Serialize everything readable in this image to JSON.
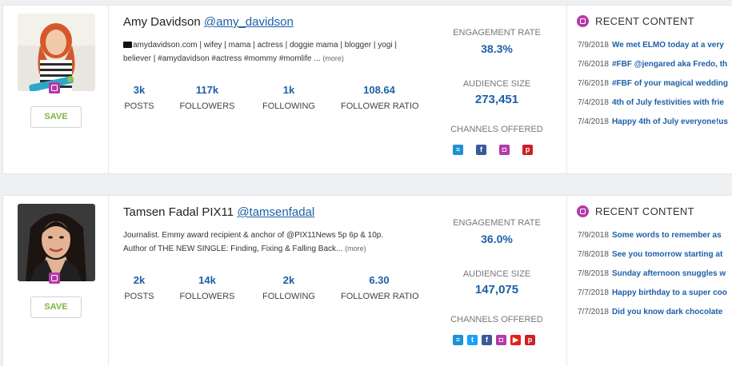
{
  "influencers": [
    {
      "name": "Amy Davidson",
      "handle": "@amy_davidson",
      "bio_line1": "amydavidson.com | wifey | mama | actress | doggie mama | blogger | yogi |",
      "bio_line2": "believer | #amydavidson #actress #mommy #momlife ...",
      "more": "(more)",
      "save_label": "SAVE",
      "stats": [
        {
          "value": "3k",
          "label": "POSTS"
        },
        {
          "value": "117k",
          "label": "FOLLOWERS"
        },
        {
          "value": "1k",
          "label": "FOLLOWING"
        },
        {
          "value": "108.64",
          "label": "FOLLOWER RATIO"
        }
      ],
      "engagement_label": "ENGAGEMENT RATE",
      "engagement_value": "38.3%",
      "audience_label": "AUDIENCE SIZE",
      "audience_value": "273,451",
      "channels_label": "CHANNELS OFFERED",
      "channels": [
        "website-icon",
        "facebook-icon",
        "instagram-icon",
        "pinterest-icon"
      ],
      "recent_title": "RECENT CONTENT",
      "recent": [
        {
          "date": "7/9/2018",
          "text": "We met ELMO today at a very"
        },
        {
          "date": "7/6/2018",
          "text": "#FBF @jengared aka Fredo, th"
        },
        {
          "date": "7/6/2018",
          "text": "#FBF of your magical wedding"
        },
        {
          "date": "7/4/2018",
          "text": "4th of July festivities with frie"
        },
        {
          "date": "7/4/2018",
          "text": "Happy 4th of July everyone!us"
        }
      ]
    },
    {
      "name": "Tamsen Fadal PIX11",
      "handle": "@tamsenfadal",
      "bio_line1": "Journalist. Emmy award recipient & anchor of @PIX11News 5p 6p & 10p.",
      "bio_line2": "Author of THE NEW SINGLE: Finding, Fixing & Falling Back...",
      "more": "(more)",
      "save_label": "SAVE",
      "stats": [
        {
          "value": "2k",
          "label": "POSTS"
        },
        {
          "value": "14k",
          "label": "FOLLOWERS"
        },
        {
          "value": "2k",
          "label": "FOLLOWING"
        },
        {
          "value": "6.30",
          "label": "FOLLOWER RATIO"
        }
      ],
      "engagement_label": "ENGAGEMENT RATE",
      "engagement_value": "36.0%",
      "audience_label": "AUDIENCE SIZE",
      "audience_value": "147,075",
      "channels_label": "CHANNELS OFFERED",
      "channels": [
        "website-icon",
        "twitter-icon",
        "facebook-icon",
        "instagram-icon",
        "youtube-icon",
        "pinterest-icon"
      ],
      "recent_title": "RECENT CONTENT",
      "recent": [
        {
          "date": "7/9/2018",
          "text": "Some words to remember as"
        },
        {
          "date": "7/8/2018",
          "text": "See you tomorrow starting at"
        },
        {
          "date": "7/8/2018",
          "text": "Sunday afternoon snuggles w"
        },
        {
          "date": "7/7/2018",
          "text": "Happy birthday to a super coo"
        },
        {
          "date": "7/7/2018",
          "text": "Did you know dark chocolate"
        }
      ]
    }
  ],
  "colors": {
    "accent_blue": "#1d5fa7",
    "instagram": "#b43aa8",
    "save_green": "#7cb342"
  }
}
